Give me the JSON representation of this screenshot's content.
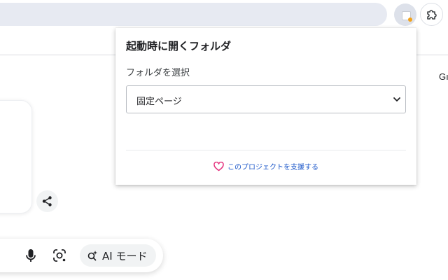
{
  "popup": {
    "title": "起動時に開くフォルダ",
    "folder_label": "フォルダを選択",
    "selected_folder": "固定ページ",
    "support_link": "このプロジェクトを支援する"
  },
  "page": {
    "corner_text": "Gı",
    "ai_mode_label": "AI モード"
  },
  "icons": {
    "extension": "puzzle-icon",
    "share": "share-icon",
    "mic": "microphone-icon",
    "lens": "lens-camera-icon",
    "ai_mode": "sparkle-search-icon",
    "support": "heart-icon",
    "dropdown": "chevron-down-icon"
  },
  "colors": {
    "link": "#1a56c9",
    "heart": "#e5357f",
    "omnibox": "#e7eaf2"
  }
}
